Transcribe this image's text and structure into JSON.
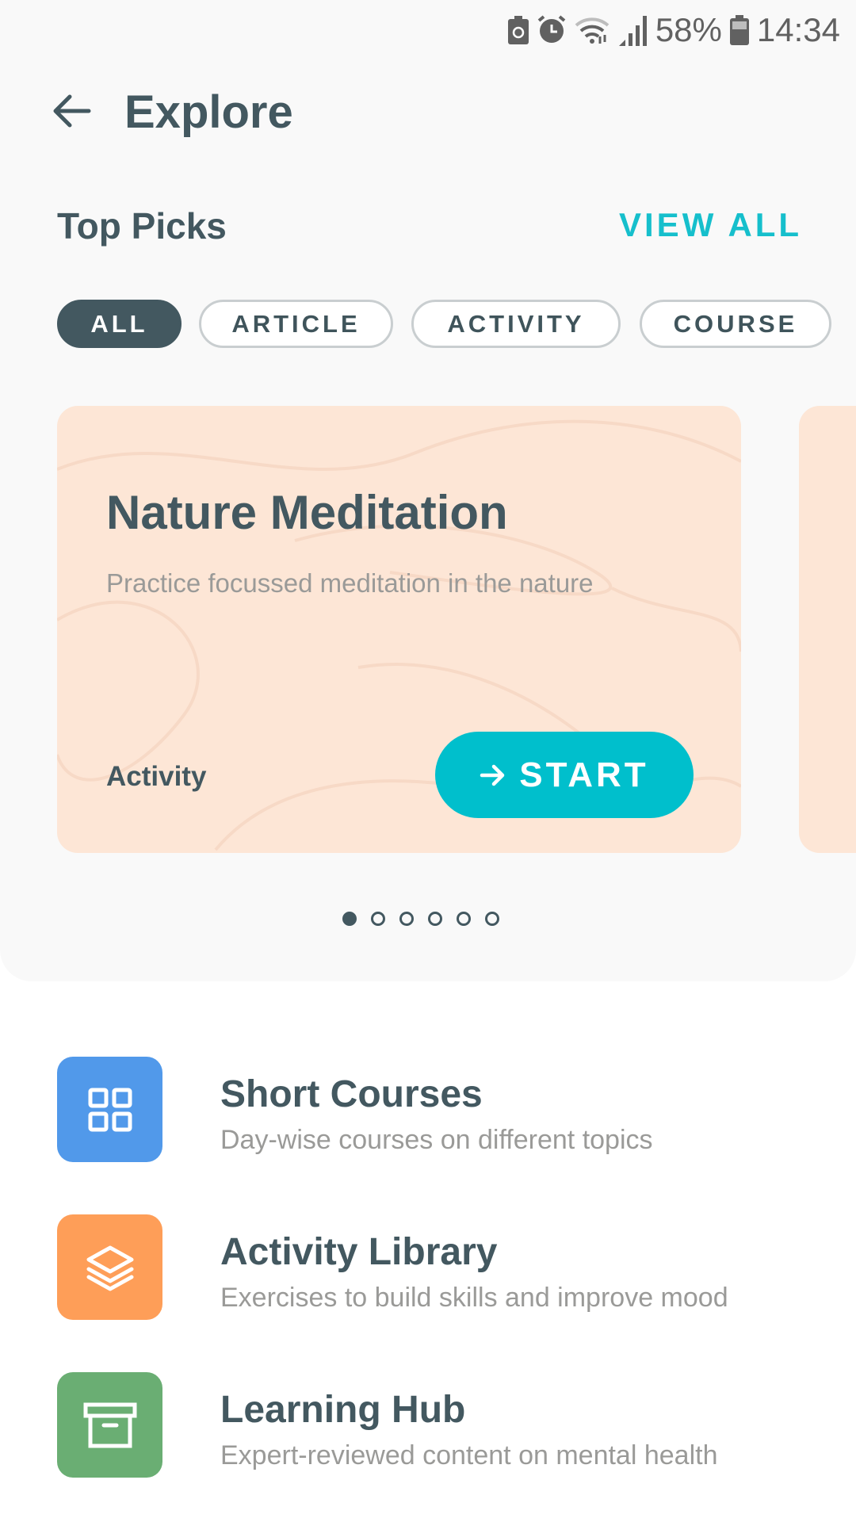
{
  "status_bar": {
    "battery_percent": "58%",
    "time": "14:34",
    "icons": [
      "battery-saver-icon",
      "alarm-icon",
      "wifi-icon",
      "signal-icon",
      "battery-icon"
    ]
  },
  "header": {
    "title": "Explore",
    "back_icon": "arrow-left-icon"
  },
  "top_picks": {
    "title": "Top Picks",
    "view_all": "VIEW ALL",
    "filters": [
      {
        "label": "ALL",
        "selected": true
      },
      {
        "label": "ARTICLE",
        "selected": false
      },
      {
        "label": "ACTIVITY",
        "selected": false
      },
      {
        "label": "COURSE",
        "selected": false
      }
    ],
    "cards": [
      {
        "title": "Nature Meditation",
        "subtitle": "Practice focussed meditation in the nature",
        "type": "Activity",
        "button": "START"
      }
    ],
    "page_count": 6,
    "current_page": 1
  },
  "list": [
    {
      "title": "Short Courses",
      "subtitle": "Day-wise courses on different topics",
      "icon": "grid-icon",
      "color": "#5199ea"
    },
    {
      "title": "Activity Library",
      "subtitle": "Exercises to build skills and improve mood",
      "icon": "layers-icon",
      "color": "#fe9e58"
    },
    {
      "title": "Learning Hub",
      "subtitle": "Expert-reviewed content on mental health",
      "icon": "archive-box-icon",
      "color": "#6aae73"
    }
  ],
  "colors": {
    "accent": "#00bfcc",
    "card_bg": "#fde6d6",
    "text_dark": "#435860"
  }
}
